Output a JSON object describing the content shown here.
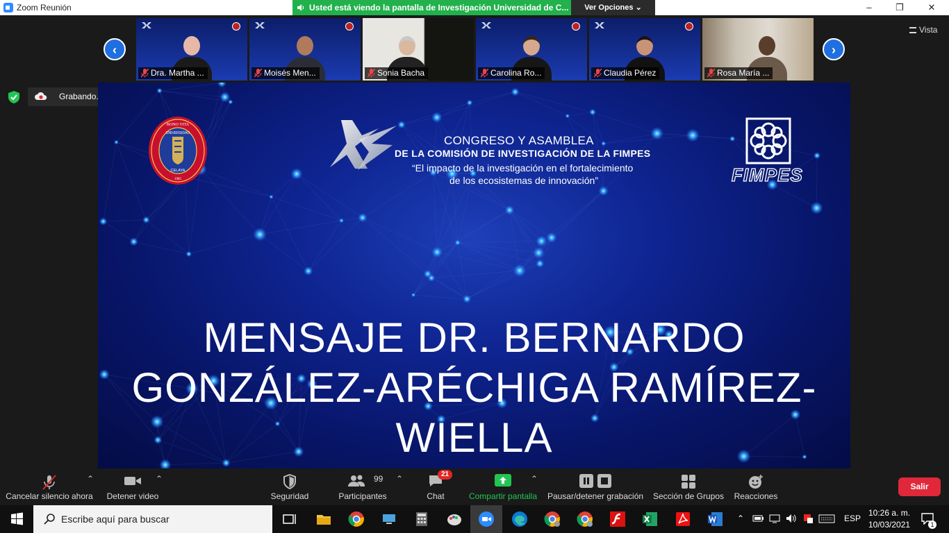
{
  "window": {
    "title": "Zoom Reunión",
    "share_banner": "Usted está viendo la pantalla de Investigación Universidad de C...",
    "view_options": "Ver Opciones",
    "minimize": "–",
    "maximize": "❐",
    "close": "✕"
  },
  "view_button": "Vista",
  "participants": [
    {
      "name": "Dra. Martha ..."
    },
    {
      "name": "Moisés Men..."
    },
    {
      "name": "Sonia Bacha"
    },
    {
      "name": "Carolina Ro..."
    },
    {
      "name": "Claudia Pérez"
    },
    {
      "name": "Rosa María ..."
    }
  ],
  "recording": {
    "label": "Grabando..."
  },
  "slide": {
    "congreso_title": "CONGRESO Y ASAMBLEA",
    "congreso_subtitle": "DE LA COMISIÓN DE INVESTIGACIÓN DE LA FIMPES",
    "quote_line1": "“El impacto de la investigación en el fortalecimiento",
    "quote_line2": "de los ecosistemas de innovación”",
    "fimpes": "FIMPES",
    "message_line1": "MENSAJE DR. BERNARDO",
    "message_line2": "GONZÁLEZ-ARÉCHIGA RAMÍREZ-",
    "message_line3": "WIELLA"
  },
  "toolbar": {
    "mute": "Cancelar silencio ahora",
    "video": "Detener video",
    "security": "Seguridad",
    "participants": "Participantes",
    "participants_count": "99",
    "chat": "Chat",
    "chat_badge": "21",
    "share": "Compartir pantalla",
    "record": "Pausar/detener grabación",
    "breakout": "Sección de Grupos",
    "reactions": "Reacciones",
    "leave": "Salir"
  },
  "taskbar": {
    "search_placeholder": "Escribe aquí para buscar",
    "language": "ESP",
    "time": "10:26 a. m.",
    "date": "10/03/2021",
    "notifications": "1"
  },
  "colors": {
    "accent_blue": "#2d8cff",
    "share_green": "#22b14c",
    "leave_red": "#e0283a",
    "slide_blue": "#0e2490"
  }
}
